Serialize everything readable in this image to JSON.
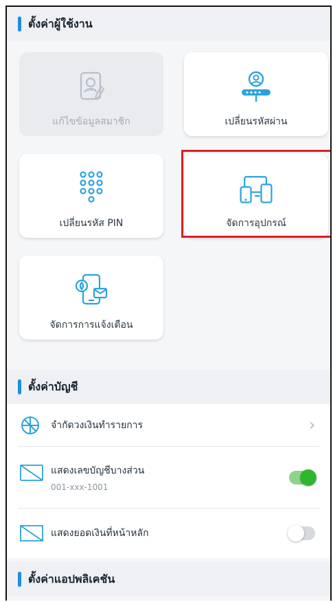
{
  "sections": {
    "user_settings": "ตั้งค่าผู้ใช้งาน",
    "account_settings": "ตั้งค่าบัญชี",
    "app_settings": "ตั้งค่าแอปพลิเคชัน"
  },
  "cards": {
    "edit_member": {
      "label": "แก้ไขข้อมูลสมาชิก",
      "icon": "member-profile-icon",
      "enabled": false
    },
    "change_password": {
      "label": "เปลี่ยนรหัสผ่าน",
      "icon": "user-password-icon",
      "enabled": true
    },
    "change_pin": {
      "label": "เปลี่ยนรหัส PIN",
      "icon": "pin-keypad-icon",
      "enabled": true
    },
    "manage_devices": {
      "label": "จัดการอุปกรณ์",
      "icon": "devices-icon",
      "enabled": true,
      "highlighted": true
    },
    "manage_notifications": {
      "label": "จัดการการแจ้งเตือน",
      "icon": "notification-phone-icon",
      "enabled": true
    }
  },
  "account_rows": {
    "limit": {
      "label": "จำกัดวงเงินทำรายการ",
      "icon": "limit-pie-icon"
    },
    "show_partial": {
      "label": "แสดงเลขบัญชีบางส่วน",
      "sub": "001-xxx-1001",
      "icon": "account-card-icon",
      "toggle_on": true
    },
    "show_balance": {
      "label": "แสดงยอดเงินที่หน้าหลัก",
      "icon": "account-card-icon",
      "toggle_on": false
    }
  },
  "colors": {
    "accent": "#1e8fe0",
    "icon_blue": "#2aa3dc",
    "toggle_on": "#2fb52f",
    "highlight": "#e01d1d"
  }
}
